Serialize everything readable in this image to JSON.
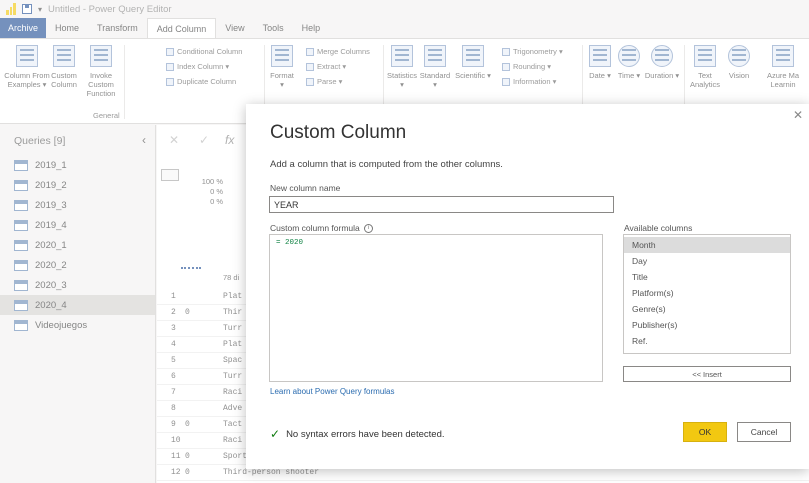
{
  "window": {
    "title": "Untitled - Power Query Editor"
  },
  "tabs": [
    "Archive",
    "Home",
    "Transform",
    "Add Column",
    "View",
    "Tools",
    "Help"
  ],
  "ribbon": {
    "column_from_examples": "Column From Examples ▾",
    "custom_column": "Custom Column",
    "invoke_custom_function": "Invoke Custom Function",
    "group_general": "General",
    "conditional_column": "Conditional Column",
    "index_column": "Index Column ▾",
    "duplicate_column": "Duplicate Column",
    "format": "Format ▾",
    "merge_columns": "Merge Columns",
    "extract": "Extract ▾",
    "parse": "Parse ▾",
    "statistics": "Statistics ▾",
    "standard": "Standard ▾",
    "scientific": "Scientific ▾",
    "trigonometry": "Trigonometry ▾",
    "rounding": "Rounding ▾",
    "information": "Information ▾",
    "date": "Date ▾",
    "time": "Time ▾",
    "duration": "Duration ▾",
    "text_analytics": "Text Analytics",
    "vision": "Vision",
    "azure_ml": "Azure Ma Learnin"
  },
  "queries": {
    "header": "Queries [9]",
    "items": [
      "2019_1",
      "2019_2",
      "2019_3",
      "2019_4",
      "2020_1",
      "2020_2",
      "2020_3",
      "2020_4",
      "Videojuegos"
    ],
    "selected": "2020_4"
  },
  "grid": {
    "stats": [
      "100 %",
      "0 %",
      "0 %"
    ],
    "count": "78 di",
    "rows": [
      {
        "n": "1",
        "a": "",
        "b": "Plat"
      },
      {
        "n": "2",
        "a": "0",
        "b": "Thir"
      },
      {
        "n": "3",
        "a": "",
        "b": "Turr"
      },
      {
        "n": "4",
        "a": "",
        "b": "Plat"
      },
      {
        "n": "5",
        "a": "",
        "b": "Spac"
      },
      {
        "n": "6",
        "a": "",
        "b": "Turr"
      },
      {
        "n": "7",
        "a": "",
        "b": "Raci"
      },
      {
        "n": "8",
        "a": "",
        "b": "Adve"
      },
      {
        "n": "9",
        "a": "0",
        "b": "Tact"
      },
      {
        "n": "10",
        "a": "",
        "b": "Raci"
      },
      {
        "n": "11",
        "a": "0",
        "b": "Sports"
      },
      {
        "n": "12",
        "a": "0",
        "b": "Third-person shooter"
      }
    ]
  },
  "dialog": {
    "title": "Custom Column",
    "description": "Add a column that is computed from the other columns.",
    "new_column_label": "New column name",
    "new_column_value": "YEAR",
    "formula_label": "Custom column formula",
    "formula": "= 2020",
    "available_label": "Available columns",
    "available_columns": [
      "Month",
      "Day",
      "Title",
      "Platform(s)",
      "Genre(s)",
      "Publisher(s)",
      "Ref."
    ],
    "insert_label": "<< Insert",
    "learn_link": "Learn about Power Query formulas",
    "status": "No syntax errors have been detected.",
    "ok_label": "OK",
    "cancel_label": "Cancel"
  }
}
